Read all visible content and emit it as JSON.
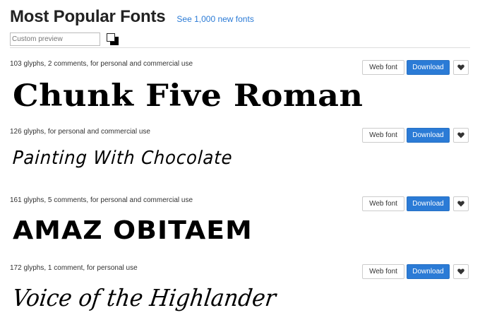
{
  "header": {
    "title": "Most Popular Fonts",
    "new_fonts_link": "See 1,000 new fonts"
  },
  "preview_controls": {
    "placeholder": "Custom preview",
    "foreground_color": "#ffffff",
    "background_color": "#000000"
  },
  "buttons": {
    "web_font": "Web font",
    "download": "Download",
    "favorite_icon": "heart-icon"
  },
  "colors": {
    "accent": "#2b7bd6"
  },
  "fonts": [
    {
      "meta": "103 glyphs, 2 comments, for personal and commercial use",
      "preview": "Chunk Five Roman"
    },
    {
      "meta": "126 glyphs, for personal and commercial use",
      "preview": "Painting With Chocolate"
    },
    {
      "meta": "161 glyphs, 5 comments, for personal and commercial use",
      "preview": "AMAZ OBITAEM"
    },
    {
      "meta": "172 glyphs, 1 comment, for personal use",
      "preview": "Voice of the Highlander"
    }
  ]
}
